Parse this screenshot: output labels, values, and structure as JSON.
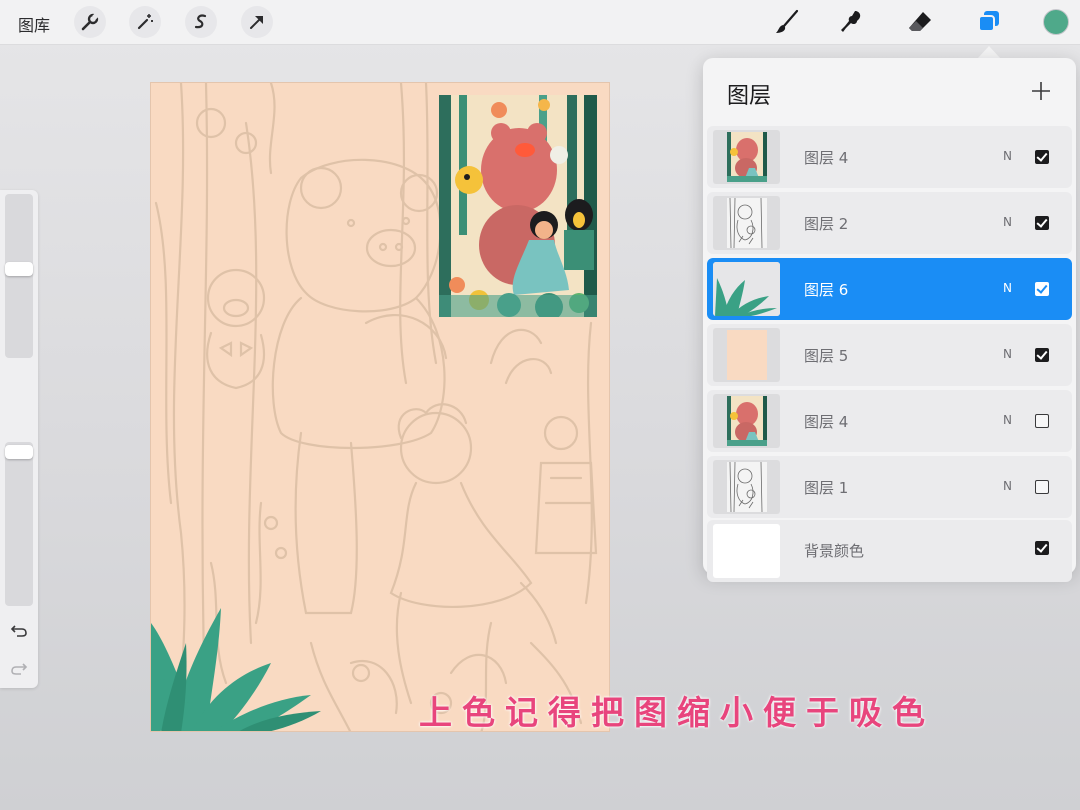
{
  "topbar": {
    "gallery_label": "图库",
    "tools_left": [
      "wrench-icon",
      "magic-wand-icon",
      "selection-icon",
      "transform-arrow-icon"
    ],
    "tools_right": [
      "brush-icon",
      "smudge-icon",
      "eraser-icon",
      "layers-icon"
    ],
    "active_color": "#4fa98a"
  },
  "sidebar": {
    "brush_size_level": 0.55,
    "opacity_level": 0.02
  },
  "layers_panel": {
    "title": "图层",
    "layers": [
      {
        "name": "图层 4",
        "blend": "N",
        "visible": true,
        "selected": false,
        "thumb": "illustration"
      },
      {
        "name": "图层 2",
        "blend": "N",
        "visible": true,
        "selected": false,
        "thumb": "sketch"
      },
      {
        "name": "图层 6",
        "blend": "N",
        "visible": true,
        "selected": true,
        "thumb": "leaves"
      },
      {
        "name": "图层 5",
        "blend": "N",
        "visible": true,
        "selected": false,
        "thumb": "peach"
      },
      {
        "name": "图层 4",
        "blend": "N",
        "visible": false,
        "selected": false,
        "thumb": "illustration"
      },
      {
        "name": "图层 1",
        "blend": "N",
        "visible": false,
        "selected": false,
        "thumb": "sketch"
      }
    ],
    "background": {
      "name": "背景颜色",
      "visible": true,
      "color": "#ffffff"
    }
  },
  "canvas": {
    "background_color": "#f9dac2",
    "caption": "上色记得把图缩小便于吸色",
    "caption_color": "#e8457d"
  }
}
